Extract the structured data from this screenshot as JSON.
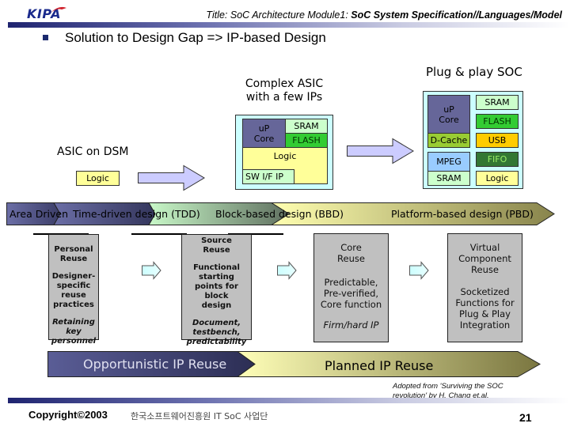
{
  "header": {
    "logo": "KIPA",
    "title_prefix": "Title: SoC Architecture  Module1: ",
    "title_main": "SoC System Specification//Languages/Model"
  },
  "bullet": {
    "text": "Solution to Design Gap => IP-based Design"
  },
  "diagram": {
    "stage1": {
      "label": "ASIC on DSM",
      "blocks": [
        "Logic"
      ]
    },
    "stage2": {
      "label_line1": "Complex ASIC",
      "label_line2": "with a few IPs",
      "blocks": {
        "up_core": "uP\nCore",
        "sram": "SRAM",
        "flash": "FLASH",
        "logic": "Logic",
        "sw_if_ip": "SW I/F IP"
      }
    },
    "stage3": {
      "label": "Plug & play SOC",
      "blocks": {
        "up_core": "uP\nCore",
        "d_cache": "D-Cache",
        "mpeg": "MPEG",
        "sram_left": "SRAM",
        "sram_right": "SRAM",
        "flash": "FLASH",
        "usb": "USB",
        "fifo": "FIFO",
        "logic": "Logic"
      }
    }
  },
  "evolution": {
    "phases": [
      "Area Driven",
      "Time-driven design (TDD)",
      "Block-based design (BBD)",
      "Platform-based design (PBD)"
    ],
    "colors": {
      "dark": "#3f4170",
      "blue": "#6b6ea6",
      "green": "#c8f5c8",
      "olive": "#6b7a5e",
      "yellow": "#ffffb0",
      "khaki": "#8a8650"
    }
  },
  "reuse_boxes": [
    {
      "title": [
        "Personal",
        "Reuse"
      ],
      "desc": [
        "Designer-",
        "specific",
        "reuse practices"
      ],
      "note": [
        "Retaining",
        "key personnel"
      ]
    },
    {
      "title": [
        "Source",
        "Reuse"
      ],
      "desc": [
        "Functional",
        "starting",
        "points for block",
        "design"
      ],
      "note": [
        "Document,",
        "testbench,",
        "predictability"
      ]
    },
    {
      "title": [
        "Core",
        "Reuse"
      ],
      "desc": [
        "Predictable,",
        "Pre-verified,",
        "Core function"
      ],
      "note": [
        "Firm/hard IP"
      ]
    },
    {
      "title": [
        "Virtual",
        "Component",
        "Reuse"
      ],
      "desc": [
        "Socketized",
        "Functions for",
        "Plug & Play",
        "Integration"
      ],
      "note": []
    }
  ],
  "reuse_bar": {
    "left": "Opportunistic IP Reuse",
    "right": "Planned IP Reuse"
  },
  "credit": {
    "line1": "Adopted from 'Surviving the SOC",
    "line2": "revolution' by H. Chang et.al."
  },
  "footer": {
    "copyright": "Copyright©2003",
    "org": "한국소프트웨어진흥원  IT SoC 사업단",
    "page": "21"
  }
}
